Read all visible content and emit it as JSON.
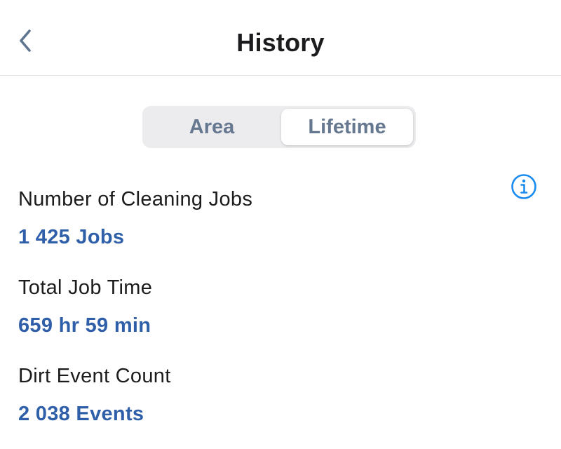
{
  "header": {
    "title": "History",
    "back_icon": "chevron-left-icon"
  },
  "tabs": [
    {
      "label": "Area",
      "selected": false
    },
    {
      "label": "Lifetime",
      "selected": true
    }
  ],
  "info_icon": "info-circle-icon",
  "stats": [
    {
      "label": "Number of Cleaning Jobs",
      "value": "1 425 Jobs"
    },
    {
      "label": "Total Job Time",
      "value": "659 hr 59 min"
    },
    {
      "label": "Dirt Event Count",
      "value": "2 038 Events"
    }
  ],
  "colors": {
    "accent": "#2f5fa8",
    "info": "#1a8cf0",
    "tab_text": "#66788f",
    "back_chevron": "#5f7590"
  }
}
